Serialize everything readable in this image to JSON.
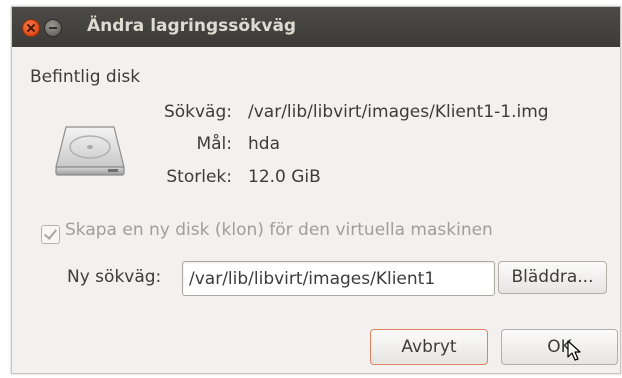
{
  "window": {
    "title": "Ändra lagringssökväg"
  },
  "existing_disk": {
    "section_label": "Befintlig disk",
    "path_label": "Sökväg:",
    "path_value": "/var/lib/libvirt/images/Klient1-1.img",
    "target_label": "Mål:",
    "target_value": "hda",
    "size_label": "Storlek:",
    "size_value": "12.0 GiB"
  },
  "clone_option": {
    "label": "Skapa en ny disk (klon) för den virtuella maskinen",
    "checked": true,
    "enabled": false
  },
  "new_path": {
    "label": "Ny sökväg:",
    "value": "/var/lib/libvirt/images/Klient1",
    "browse_label": "Bläddra..."
  },
  "buttons": {
    "cancel_label": "Avbryt",
    "ok_label": "OK"
  },
  "colors": {
    "titlebar": "#3c3b37",
    "dialog_bg": "#f2f1f0",
    "close_button": "#df4a16",
    "focus_outline": "#e0835e"
  },
  "icons": {
    "close": "close-icon",
    "minimize": "minimize-icon",
    "disk": "hard-disk-icon",
    "pointer": "mouse-pointer-icon"
  }
}
